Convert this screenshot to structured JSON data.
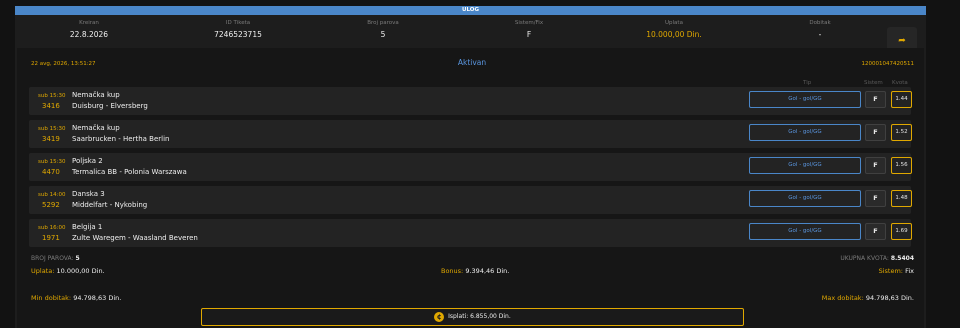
{
  "header": {
    "title": "ULOG"
  },
  "summary": [
    {
      "label": "Kreiran",
      "value": "22.8.2026"
    },
    {
      "label": "ID Tiketa",
      "value": "7246523715"
    },
    {
      "label": "Broj parova",
      "value": "5"
    },
    {
      "label": "Sistem/Fix",
      "value": "F"
    },
    {
      "label": "Uplata",
      "value": "10.000,00 Din."
    },
    {
      "label": "Dobitak",
      "value": "-"
    }
  ],
  "share_icon": "share-arrow-icon",
  "ticket": {
    "date": "22 avg, 2026, 13:51:27",
    "status": "Aktivan",
    "number": "120001047420511",
    "col_tip": "Tip",
    "col_sistem": "Sistem",
    "col_kvota": "Kvota"
  },
  "matches": [
    {
      "time": "sub 15:30",
      "code": "3416",
      "league": "Nemačka kup",
      "teams": "Duisburg - Elversberg",
      "tip": "Gol - gol/GG",
      "flag": "F",
      "odd": "1.44"
    },
    {
      "time": "sub 15:30",
      "code": "3419",
      "league": "Nemačka kup",
      "teams": "Saarbrucken - Hertha Berlin",
      "tip": "Gol - gol/GG",
      "flag": "F",
      "odd": "1.52"
    },
    {
      "time": "sub 15:30",
      "code": "4470",
      "league": "Poljska 2",
      "teams": "Termalica BB - Polonia Warszawa",
      "tip": "Gol - gol/GG",
      "flag": "F",
      "odd": "1.56"
    },
    {
      "time": "sub 14:00",
      "code": "5292",
      "league": "Danska 3",
      "teams": "Middelfart - Nykobing",
      "tip": "Gol - gol/GG",
      "flag": "F",
      "odd": "1.48"
    },
    {
      "time": "sub 16:00",
      "code": "1971",
      "league": "Belgija 1",
      "teams": "Zulte Waregem - Waasland Beveren",
      "tip": "Gol - gol/GG",
      "flag": "F",
      "odd": "1.69"
    }
  ],
  "totals": {
    "pairs_label": "BROJ PAROVA:",
    "pairs_value": "5",
    "odds_label": "UKUPNA KVOTA:",
    "odds_value": "8.5404",
    "stake_label": "Uplata:",
    "stake_value": "10.000,00 Din.",
    "bonus_label": "Bonus:",
    "bonus_value": "9.394,46 Din.",
    "system_label": "Sistem:",
    "system_value": "Fix",
    "min_win_label": "Min dobitak:",
    "min_win_value": "94.798,63 Din.",
    "max_win_label": "Max dobitak:",
    "max_win_value": "94.798,63 Din."
  },
  "payout": {
    "label": "Isplati: 6.855,00 Din.",
    "icon": "coin-icon"
  },
  "colors": {
    "accent": "#e0a800",
    "blue": "#4a86c8",
    "panel": "#1d1d1d"
  }
}
